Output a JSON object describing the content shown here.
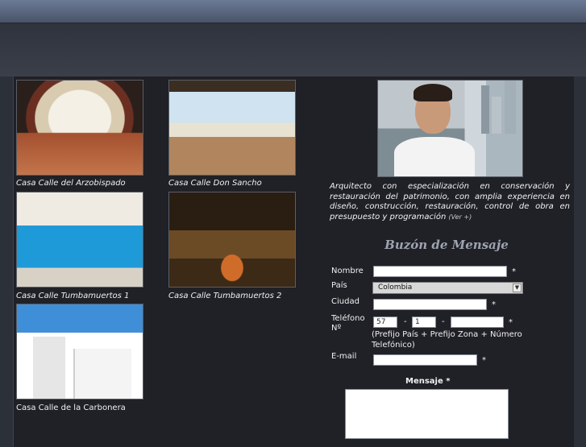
{
  "gallery": [
    {
      "caption": "Casa Calle del Arzobispado"
    },
    {
      "caption": "Casa Calle Don Sancho"
    },
    {
      "caption": "Casa Calle Tumbamuertos 1"
    },
    {
      "caption": "Casa Calle Tumbamuertos 2"
    },
    {
      "caption": "Casa Calle de la Carbonera"
    }
  ],
  "bio": {
    "text": "Arquitecto con especialización en conservación y restauración del patrimonio, con amplia experiencia en diseño, construcción, restauración, control de obra en presupuesto y programación",
    "more": "(Ver +)"
  },
  "form": {
    "title": "Buzón de Mensaje",
    "name_label": "Nombre",
    "country_label": "País",
    "country_value": "Colombia",
    "city_label": "Ciudad",
    "phone_label_1": "Teléfono",
    "phone_label_2": "Nº",
    "phone_country": "57",
    "phone_zone": "1",
    "phone_hint": "(Prefijo País + Prefijo Zona + Número Telefónico)",
    "email_label": "E-mail",
    "message_label": "Mensaje *",
    "required_mark": "*",
    "sep": "-"
  }
}
